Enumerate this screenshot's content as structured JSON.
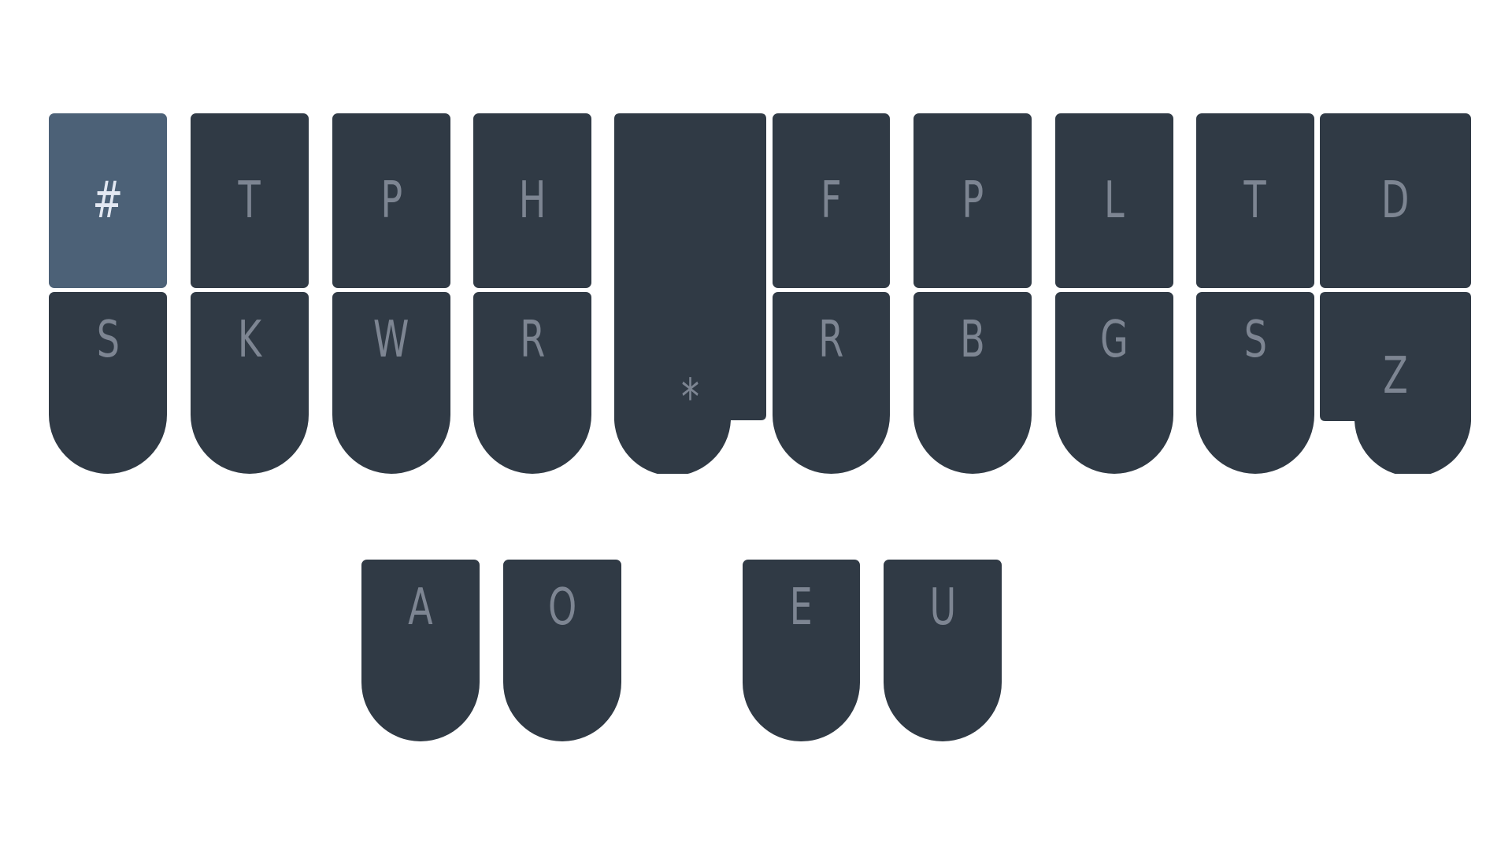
{
  "keyboard": {
    "top_row": [
      {
        "label": "#",
        "pressed": true
      },
      {
        "label": "T"
      },
      {
        "label": "P"
      },
      {
        "label": "H"
      },
      {
        "label": "F"
      },
      {
        "label": "P"
      },
      {
        "label": "L"
      },
      {
        "label": "T"
      },
      {
        "label": "D"
      }
    ],
    "bottom_row": [
      {
        "label": "S"
      },
      {
        "label": "K"
      },
      {
        "label": "W"
      },
      {
        "label": "R"
      },
      {
        "label": "R"
      },
      {
        "label": "B"
      },
      {
        "label": "G"
      },
      {
        "label": "S"
      },
      {
        "label": "Z"
      }
    ],
    "star": {
      "label": "*"
    },
    "vowels": [
      {
        "label": "A"
      },
      {
        "label": "O"
      },
      {
        "label": "E"
      },
      {
        "label": "U"
      }
    ],
    "colors": {
      "key": "#303a45",
      "key_pressed": "#4c6177",
      "label": "#7d8592",
      "label_pressed": "#e3e8f2",
      "background": "#ffffff"
    }
  }
}
